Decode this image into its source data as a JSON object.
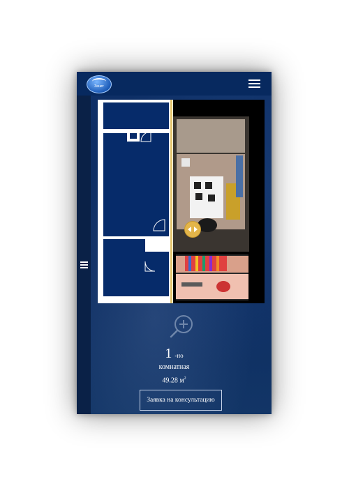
{
  "header": {
    "logo_text": "Зенит",
    "menu_icon": "hamburger-icon"
  },
  "side_menu_icon": "hamburger-icon",
  "plan": {
    "compare_handle_icon": "left-right-arrows-icon",
    "zoom_icon": "zoom-in-icon"
  },
  "apartment": {
    "rooms_number": "1",
    "rooms_suffix": "-но",
    "rooms_word": "комнатная",
    "area_value": "49.28 м",
    "area_unit_sup": "2"
  },
  "cta": {
    "label": "Заявка на консультацию"
  },
  "colors": {
    "background": "#0c2a5b",
    "header": "#07295f",
    "plan_fill": "#062b6a",
    "handle": "#e3b54a"
  }
}
